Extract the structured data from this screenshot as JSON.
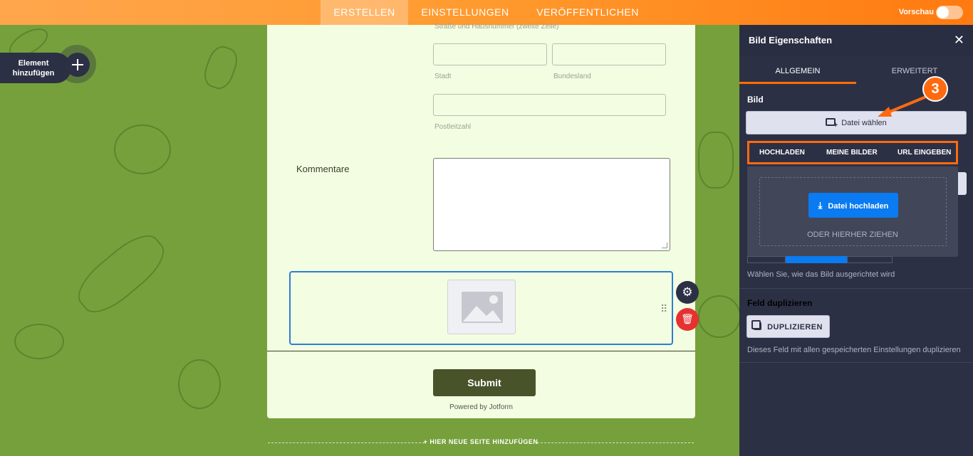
{
  "topbar": {
    "tabs": [
      {
        "label": "ERSTELLEN",
        "active": true
      },
      {
        "label": "EINSTELLUNGEN",
        "active": false
      },
      {
        "label": "VERÖFFENTLICHEN",
        "active": false
      }
    ],
    "preview_label": "Vorschau",
    "preview_on": false
  },
  "sidebar": {
    "add_element_label": "Element hinzufügen"
  },
  "form": {
    "address_line2_sublabel": "Straße und Hausnummer (zweite Zeile)",
    "city_sublabel": "Stadt",
    "state_sublabel": "Bundesland",
    "zip_sublabel": "Postleitzahl",
    "comments_label": "Kommentare",
    "submit_label": "Submit",
    "powered_by": "Powered by Jotform",
    "add_page_label": "+ HIER NEUE SEITE HINZUFÜGEN"
  },
  "panel": {
    "title": "Bild Eigenschaften",
    "tabs": [
      {
        "label": "ALLGEMEIN",
        "active": true
      },
      {
        "label": "ERWEITERT",
        "active": false
      }
    ],
    "image_section_title": "Bild",
    "choose_file_label": "Datei wählen",
    "upload_tabs": [
      "HOCHLADEN",
      "MEINE BILDER",
      "URL EINGEBEN"
    ],
    "upload_button_label": "Datei hochladen",
    "drag_here_label": "ODER HIERHER ZIEHEN",
    "align_help": "Wählen Sie, wie das Bild ausgerichtet wird",
    "duplicate_title": "Feld duplizieren",
    "duplicate_button_label": "DUPLIZIEREN",
    "duplicate_help": "Dieses Feld mit allen gespeicherten Einstellungen duplizieren"
  },
  "annotation": {
    "step_number": "3"
  },
  "colors": {
    "accent": "#ff6a10",
    "panel_bg": "#2c3045",
    "canvas_bg": "#76a03c",
    "form_bg": "#f3fde1",
    "primary_button": "#0a7bf0",
    "submit_button": "#48532a",
    "delete_button": "#e63131"
  }
}
